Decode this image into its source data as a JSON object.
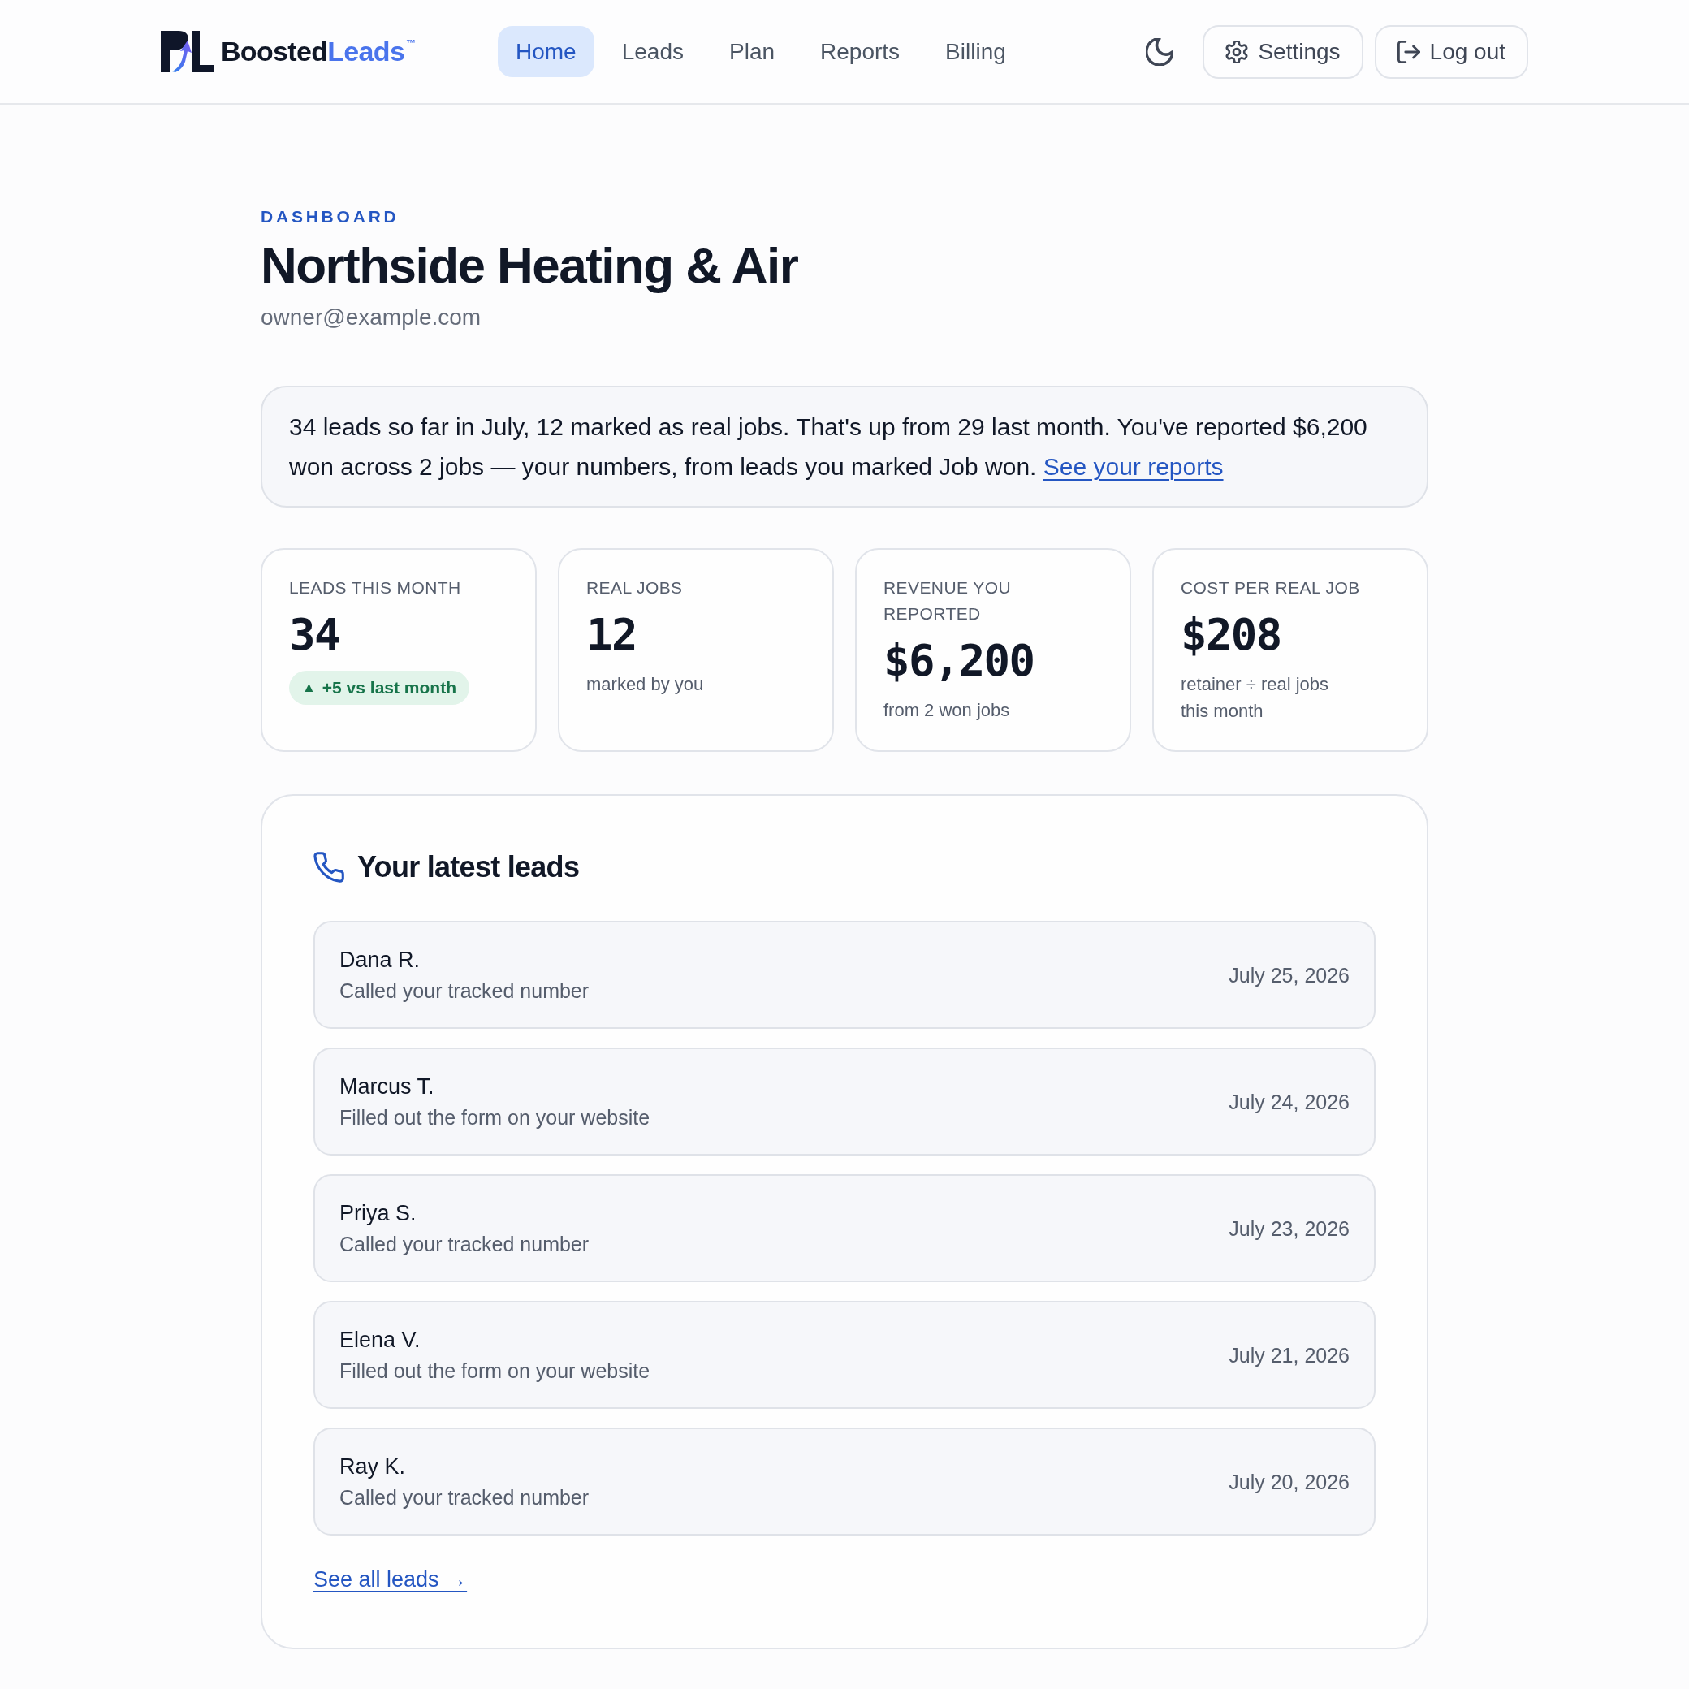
{
  "header": {
    "brand": {
      "name": "Boosted",
      "accent": "Leads",
      "trademark": "™"
    },
    "nav": [
      {
        "label": "Home",
        "selected": true
      },
      {
        "label": "Leads",
        "selected": false
      },
      {
        "label": "Plan",
        "selected": false
      },
      {
        "label": "Reports",
        "selected": false
      },
      {
        "label": "Billing",
        "selected": false
      }
    ],
    "actions": [
      {
        "kind": "theme"
      },
      {
        "kind": "settings",
        "label": "Settings"
      },
      {
        "kind": "logout",
        "label": "Log out"
      }
    ]
  },
  "page": {
    "eyebrow": "DASHBOARD",
    "title": "Northside Heating & Air",
    "email": "owner@example.com"
  },
  "summary": {
    "text": "34 leads so far in July, 12 marked as real jobs. That's up from 29 last month. You've reported $6,200 won across 2 jobs — your numbers, from leads you marked Job won.",
    "link": "See your reports"
  },
  "stats": [
    {
      "label": "LEADS THIS MONTH",
      "value": "34",
      "badge": {
        "arrow": "▲",
        "text": "+5 vs last month"
      }
    },
    {
      "label": "REAL JOBS",
      "value": "12",
      "note": "marked by you"
    },
    {
      "label": "REVENUE YOU REPORTED",
      "value": "$6,200",
      "note": "from 2 won jobs"
    },
    {
      "label": "COST PER REAL JOB",
      "value": "$208",
      "note": "retainer ÷ real jobs this month"
    }
  ],
  "latest_leads": {
    "title": "Your latest leads",
    "items": [
      {
        "name": "Dana R.",
        "source": "Called your tracked number",
        "date": "July 25, 2026"
      },
      {
        "name": "Marcus T.",
        "source": "Filled out the form on your website",
        "date": "July 24, 2026"
      },
      {
        "name": "Priya S.",
        "source": "Called your tracked number",
        "date": "July 23, 2026"
      },
      {
        "name": "Elena V.",
        "source": "Filled out the form on your website",
        "date": "July 21, 2026"
      },
      {
        "name": "Ray K.",
        "source": "Called your tracked number",
        "date": "July 20, 2026"
      }
    ],
    "link": "See all leads →"
  }
}
